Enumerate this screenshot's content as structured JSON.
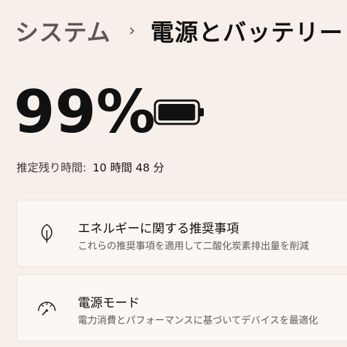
{
  "breadcrumb": {
    "parent": "システム",
    "separator": "›",
    "current": "電源とバッテリー"
  },
  "battery": {
    "percent": "99%",
    "level": 0.99,
    "estimate_label": "推定残り時間:",
    "estimate_value": "10 時間 48 分"
  },
  "cards": [
    {
      "title": "エネルギーに関する推奨事項",
      "subtitle": "これらの推奨事項を適用して二酸化炭素排出量を削減",
      "icon": "leaf-icon"
    },
    {
      "title": "電源モード",
      "subtitle": "電力消費とパフォーマンスに基づいてデバイスを最適化",
      "icon": "gauge-icon"
    }
  ]
}
